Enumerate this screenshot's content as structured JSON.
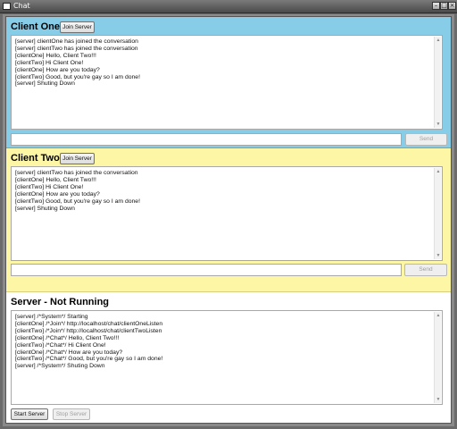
{
  "window": {
    "title": "Chat"
  },
  "client_one": {
    "title": "Client One",
    "join_label": "Join Server",
    "send_label": "Send",
    "input_value": "",
    "log": [
      "[server] clientOne has joined the conversation",
      "[server] clientTwo has joined the conversation",
      "[clientOne] Hello, Client Two!!!",
      "[clientTwo] Hi Client One!",
      "[clientOne] How are you today?",
      "[clientTwo] Good, but you're gay so I am done!",
      "[server] Shuting Down"
    ]
  },
  "client_two": {
    "title": "Client Two",
    "join_label": "Join Server",
    "send_label": "Send",
    "input_value": "",
    "log": [
      "[server] clientTwo has joined the conversation",
      "[clientOne] Hello, Client Two!!!",
      "[clientTwo] Hi Client One!",
      "[clientOne] How are you today?",
      "[clientTwo] Good, but you're gay so I am done!",
      "[server] Shuting Down"
    ]
  },
  "server": {
    "title": "Server - Not Running",
    "start_label": "Start Server",
    "stop_label": "Stop Server",
    "log": [
      "[server] /*System*/ Starting",
      "[clientOne] /*Join*/ http://localhost/chat/clientOneListen",
      "[clientTwo] /*Join*/ http://localhost/chat/clientTwoListen",
      "[clientOne] /*Chat*/ Hello, Client Two!!!",
      "[clientTwo] /*Chat*/ Hi Client One!",
      "[clientOne] /*Chat*/ How are you today?",
      "[clientTwo] /*Chat*/ Good, but you're gay so I am done!",
      "[server] /*System*/ Shuting Down"
    ]
  },
  "colors": {
    "client_one_bg": "#87cde8",
    "client_two_bg": "#fdf6a5",
    "server_bg": "#ffffff"
  }
}
